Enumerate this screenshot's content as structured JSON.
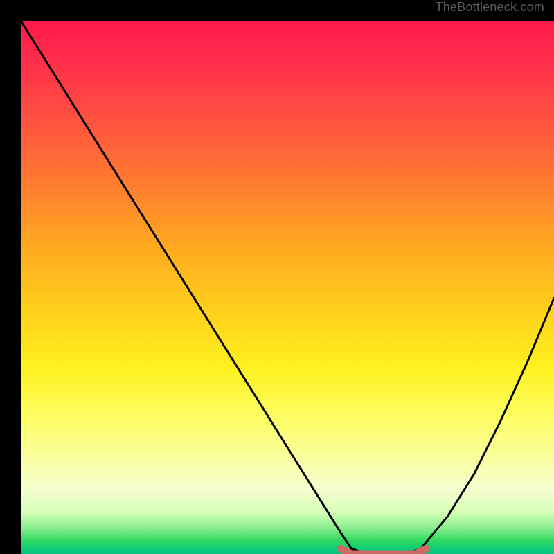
{
  "watermark": "TheBottleneck.com",
  "chart_data": {
    "type": "line",
    "title": "",
    "xlabel": "",
    "ylabel": "",
    "xlim": [
      0,
      100
    ],
    "ylim": [
      0,
      100
    ],
    "grid": false,
    "series": [
      {
        "name": "bottleneck-curve",
        "x": [
          0,
          5,
          10,
          15,
          20,
          25,
          30,
          35,
          40,
          45,
          50,
          55,
          60,
          62,
          65,
          68,
          70,
          72,
          75,
          80,
          85,
          90,
          95,
          100
        ],
        "values": [
          100,
          92,
          84,
          76,
          68,
          60,
          52,
          44,
          36,
          28,
          20,
          12,
          4,
          1,
          0,
          0,
          0,
          0,
          1,
          7,
          15,
          25,
          36,
          48
        ]
      },
      {
        "name": "sweet-spot-marker",
        "x": [
          60,
          62,
          64,
          66,
          68,
          70,
          72,
          74,
          76
        ],
        "values": [
          1,
          0,
          0,
          0,
          0,
          0,
          0,
          0,
          1
        ]
      }
    ],
    "gradient_stops": [
      {
        "pos": 0,
        "color": "#ff1a4a"
      },
      {
        "pos": 0.3,
        "color": "#ff7a30"
      },
      {
        "pos": 0.55,
        "color": "#ffd21a"
      },
      {
        "pos": 0.82,
        "color": "#faffa0"
      },
      {
        "pos": 0.95,
        "color": "#8cf090"
      },
      {
        "pos": 1.0,
        "color": "#0ac47e"
      }
    ],
    "colors": {
      "curve": "#000000",
      "marker": "#cc6b66",
      "background_frame": "#000000"
    }
  }
}
